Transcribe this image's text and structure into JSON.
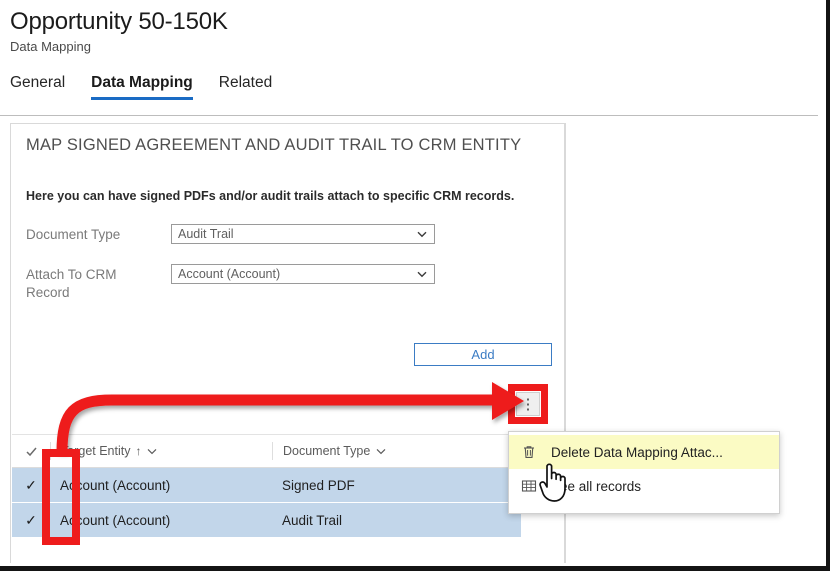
{
  "header": {
    "title": "Opportunity 50-150K",
    "subtitle": "Data Mapping"
  },
  "tabs": [
    {
      "label": "General",
      "selected": false
    },
    {
      "label": "Data Mapping",
      "selected": true
    },
    {
      "label": "Related",
      "selected": false
    }
  ],
  "card": {
    "heading": "MAP SIGNED AGREEMENT AND AUDIT TRAIL TO CRM ENTITY",
    "description": "Here you can have signed PDFs and/or audit trails attach to specific CRM records.",
    "fields": [
      {
        "label": "Document Type",
        "value": "Audit Trail",
        "icon": "chevron-down-icon"
      },
      {
        "label": "Attach To CRM Record",
        "value": "Account (Account)",
        "icon": "chevron-down-icon"
      }
    ],
    "add_button": "Add"
  },
  "overflow_button": {
    "icon": "more-vertical-icon",
    "glyph": "⋮"
  },
  "context_menu": {
    "items": [
      {
        "label": "Delete Data Mapping Attac...",
        "icon": "trash-icon",
        "highlighted": true
      },
      {
        "label": "See all records",
        "icon": "grid-icon",
        "highlighted": false
      }
    ]
  },
  "grid": {
    "select_all_icon": "checkbox-icon",
    "columns": [
      {
        "label": "Target Entity",
        "sort": "↑",
        "filter_icon": "chevron-down-icon"
      },
      {
        "label": "Document Type",
        "sort": "",
        "filter_icon": "chevron-down-icon"
      }
    ],
    "rows": [
      {
        "selected": true,
        "check": "✓",
        "target_entity": "Account (Account)",
        "document_type": "Signed PDF"
      },
      {
        "selected": true,
        "check": "✓",
        "target_entity": "Account (Account)",
        "document_type": "Audit Trail"
      }
    ]
  },
  "annotations": {
    "arrow_color": "#ee1c1c",
    "highlight_color": "#ee1c1c",
    "cursor_icon": "hand-pointer-cursor"
  },
  "colors": {
    "accent": "#1a6bc4",
    "link": "#3b7cc4",
    "row_selected": "#c2d6ea",
    "menu_highlight": "#fbfbc4"
  }
}
